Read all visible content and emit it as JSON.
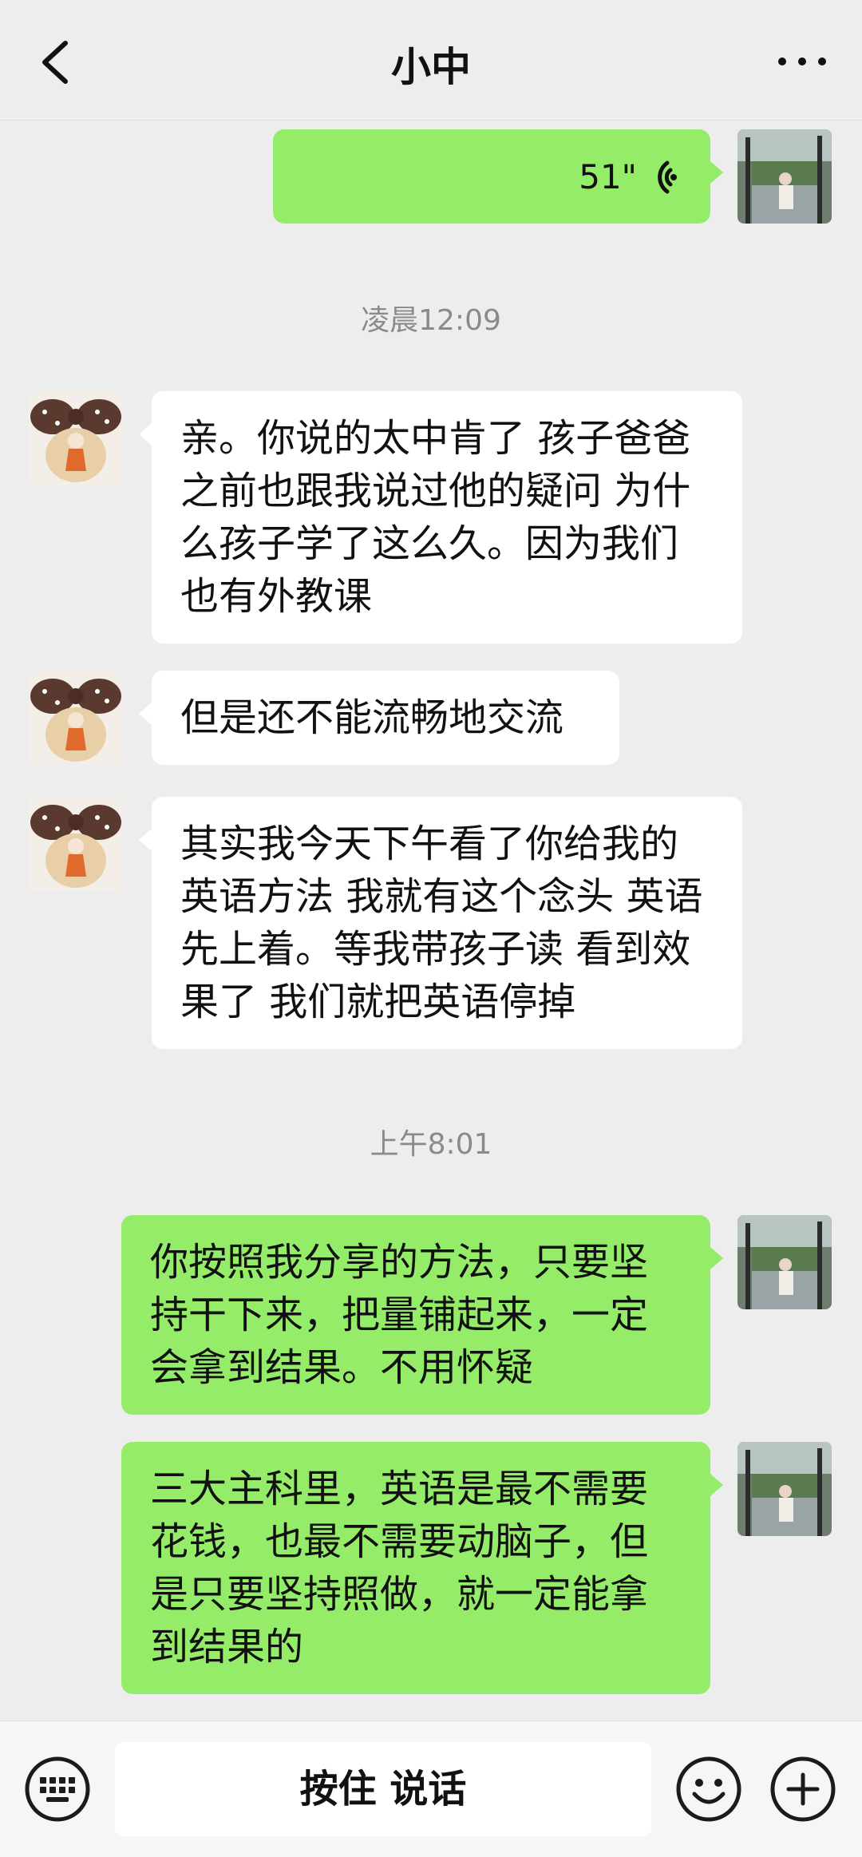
{
  "header": {
    "title": "小中"
  },
  "chat": {
    "voice_message": {
      "duration": "51\""
    },
    "timestamps": [
      "凌晨12:09",
      "上午8:01"
    ],
    "incoming": [
      "亲。你说的太中肯了 孩子爸爸之前也跟我说过他的疑问 为什么孩子学了这么久。因为我们也有外教课",
      "但是还不能流畅地交流",
      "其实我今天下午看了你给我的英语方法 我就有这个念头 英语先上着。等我带孩子读 看到效果了 我们就把英语停掉"
    ],
    "outgoing": [
      "你按照我分享的方法，只要坚持干下来，把量铺起来，一定会拿到结果。不用怀疑",
      "三大主科里，英语是最不需要花钱，也最不需要动脑子，但是只要坚持照做，就一定能拿到结果的"
    ]
  },
  "bottom_bar": {
    "hold_to_talk": "按住 说话",
    "icons": [
      "keyboard-icon",
      "emoji-icon",
      "plus-icon"
    ]
  },
  "colors": {
    "background": "#ededed",
    "outgoing_bubble": "#95ec69",
    "incoming_bubble": "#ffffff"
  }
}
